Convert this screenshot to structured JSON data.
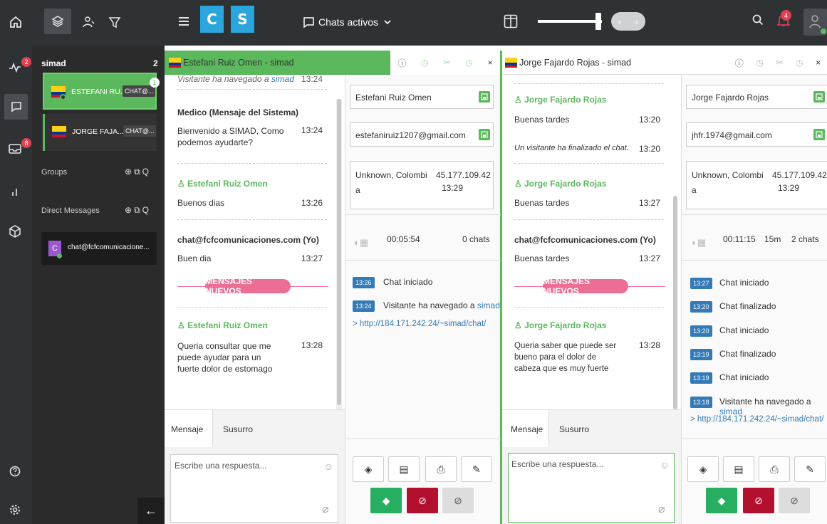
{
  "topbar": {
    "menu_icon": "hamburger-icon",
    "tile_c": "C",
    "tile_s": "S",
    "chats_label": "Chats activos",
    "bell_count": "4"
  },
  "rail": {
    "activity_badge": "2",
    "inbox_badge": "8"
  },
  "sidebar": {
    "group_name": "simad",
    "group_count": "2",
    "chats": [
      {
        "name": "ESTEFANI RU...",
        "tag": "CHAT@...",
        "badge": "1"
      },
      {
        "name": "JORGE FAJA...",
        "tag": "CHAT@..."
      }
    ],
    "groups_label": "Groups",
    "dm_label": "Direct Messages",
    "dm_name": "chat@fcfcomunicacione...",
    "dm_avatar": "C"
  },
  "colors": {
    "accent_green": "#5cb85c",
    "blue": "#337ab7",
    "pink": "#ec6e94",
    "dark": "#2f3235"
  },
  "panel1": {
    "title": "Estefani Ruiz Omen - simad",
    "top_note": "Visitante ha navegado a ",
    "top_link": "simad",
    "top_time": "13:24",
    "m1_name": "Medico (Mensaje del Sistema)",
    "m1_text": "Bienvenido a SIMAD, Como podemos ayudarte?",
    "m1_time": "13:24",
    "m2_name": "Estefani Ruiz Omen",
    "m2_text": "Buenos dias",
    "m2_time": "13:26",
    "m3_name": "chat@fcfcomunicaciones.com (Yo)",
    "m3_text": "Buen dia",
    "m3_time": "13:27",
    "new_label": "MENSAJES NUEVOS",
    "m4_name": "Estefani Ruiz Omen",
    "m4_text": "Queria consultar que me puede ayudar para un fuerte dolor de estomago",
    "m4_time": "13:28",
    "tab_msg": "Mensaje",
    "tab_whisper": "Susurro",
    "placeholder": "Escribe una respuesta...",
    "info_name": "Estefani Ruiz Omen",
    "info_email": "estefaniruiz1207@gmail.com",
    "loc": "Unknown, Colombi",
    "loc2": "a",
    "ip": "45.177.109.42",
    "ip_time": "13:29",
    "duration": "00:05:54",
    "chats": "0 chats",
    "events": [
      {
        "t": "13:26",
        "text": "Chat iniciado"
      },
      {
        "t": "13:24",
        "text": "Visitante ha navegado a ",
        "link": "simad"
      }
    ],
    "url": "> http://184.171.242.24/~simad/chat/"
  },
  "panel2": {
    "title": "Jorge Fajardo Rojas - simad",
    "m1_name": "Jorge Fajardo Rojas",
    "m1_text": "Buenas tardes",
    "m1_time": "13:20",
    "note": "Un visitante ha finalizado el chat.",
    "note_time": "13:20",
    "m2_name": "Jorge Fajardo Rojas",
    "m2_text": "Buenas tardes",
    "m2_time": "13:27",
    "m3_name": "chat@fcfcomunicaciones.com (Yo)",
    "m3_text": "Buenas tardes",
    "m3_time": "13:27",
    "new_label": "MENSAJES NUEVOS",
    "m4_name": "Jorge Fajardo Rojas",
    "m4_text": "Queria saber que puede ser bueno para el dolor de cabeza que es muy fuerte",
    "m4_time": "13:28",
    "tab_msg": "Mensaje",
    "tab_whisper": "Susurro",
    "placeholder": "Escribe una respuesta...",
    "info_name": "Jorge Fajardo Rojas",
    "info_email": "jhfr.1974@gmail.com",
    "loc": "Unknown, Colombi",
    "loc2": "a",
    "ip": "45.177.109.42",
    "ip_time": "13:29",
    "duration": "00:11:15",
    "wait": "15m",
    "chats": "2 chats",
    "events": [
      {
        "t": "13:27",
        "text": "Chat iniciado"
      },
      {
        "t": "13:20",
        "text": "Chat finalizado"
      },
      {
        "t": "13:20",
        "text": "Chat iniciado"
      },
      {
        "t": "13:19",
        "text": "Chat finalizado"
      },
      {
        "t": "13:19",
        "text": "Chat iniciado"
      },
      {
        "t": "13:18",
        "text": "Visitante ha navegado a ",
        "link": "simad"
      }
    ],
    "url": "> http://184.171.242.24/~simad/chat/"
  }
}
